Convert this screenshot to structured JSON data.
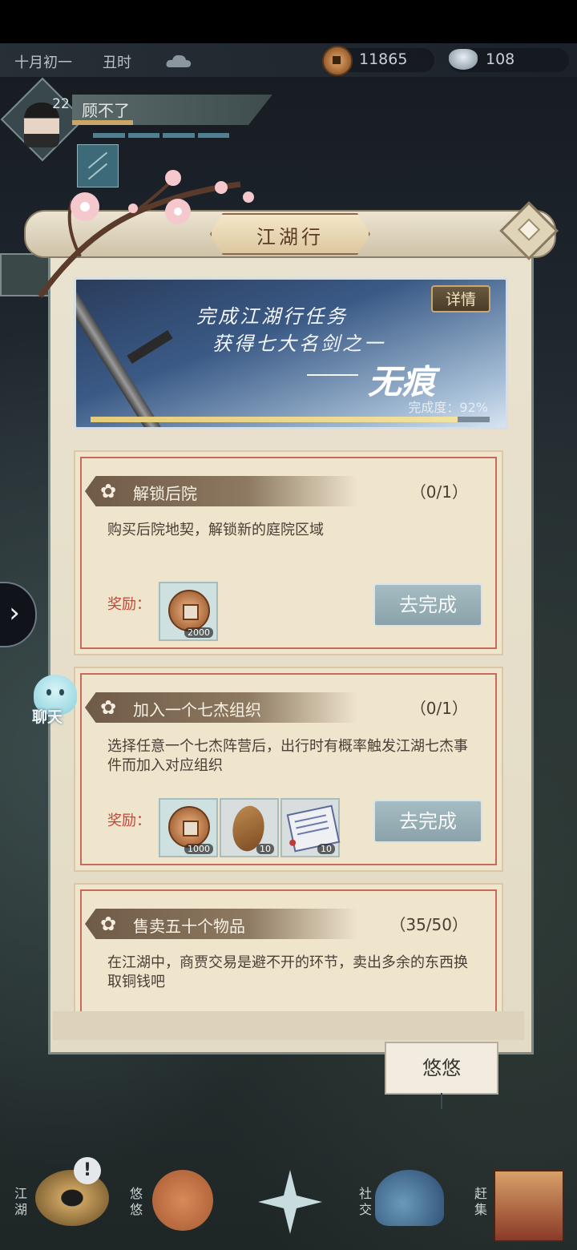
{
  "status": {
    "date": "十月初一",
    "hour": "丑时",
    "weather_icon": "cloud-icon",
    "coins": "11865",
    "silver": "108"
  },
  "player": {
    "level": "22",
    "name": "顾不了",
    "badge_icon": "rank-badge-icon"
  },
  "panel": {
    "title": "江湖行",
    "banner": {
      "line1": "完成江湖行任务",
      "line2": "获得七大名剑之一",
      "sword_name": "无痕",
      "progress_label": "完成度：92%",
      "progress": 0.92,
      "detail_label": "详情"
    },
    "quests": [
      {
        "title": "解锁后院",
        "count": "（0/1）",
        "desc": "购买后院地契，解锁新的庭院区域",
        "reward_label": "奖励：",
        "rewards": [
          {
            "icon": "copper-coin-icon",
            "qty": "2000"
          }
        ],
        "action": "去完成"
      },
      {
        "title": "加入一个七杰组织",
        "count": "（0/1）",
        "desc": "选择任意一个七杰阵营后，出行时有概率触发江湖七杰事件而加入对应组织",
        "reward_label": "奖励：",
        "rewards": [
          {
            "icon": "copper-coin-icon",
            "qty": "1000"
          },
          {
            "icon": "wood-icon",
            "qty": "10"
          },
          {
            "icon": "scroll-icon",
            "qty": "10"
          }
        ],
        "action": "去完成"
      },
      {
        "title": "售卖五十个物品",
        "count": "（35/50）",
        "desc": "在江湖中，商贾交易是避不开的环节，卖出多余的东西换取铜钱吧"
      }
    ]
  },
  "npc_tag": "悠悠",
  "chat_label": "聊天",
  "nav": {
    "items": [
      {
        "label": "江湖",
        "icon": "straw-hat-icon"
      },
      {
        "label": "悠悠",
        "icon": "crane-icon"
      },
      {
        "label": "",
        "icon": "compass-star-icon"
      },
      {
        "label": "社交",
        "icon": "wave-icon"
      },
      {
        "label": "赶集",
        "icon": "market-cart-icon"
      }
    ],
    "alert_glyph": "!"
  },
  "colors": {
    "accent_gold": "#caa668",
    "reward_red": "#c04a3a",
    "button_blue_gray": "#8aa2aa"
  }
}
